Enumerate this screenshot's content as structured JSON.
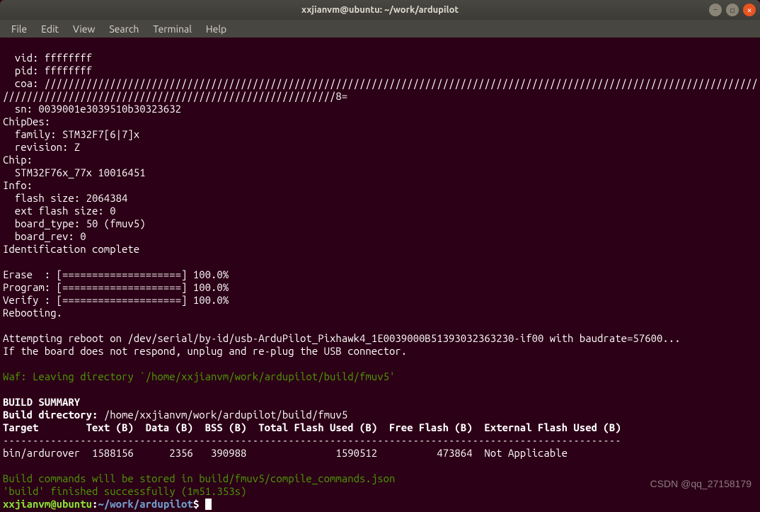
{
  "window": {
    "title": "xxjianvm@ubuntu: ~/work/ardupilot"
  },
  "menu": {
    "file": "File",
    "edit": "Edit",
    "view": "View",
    "search": "Search",
    "terminal": "Terminal",
    "help": "Help"
  },
  "term": {
    "vid": "  vid: ffffffff",
    "pid": "  pid: ffffffff",
    "coa1": "  coa: ////////////////////////////////////////////////////////////////////////////////////////////////////////////////////////",
    "coa2": "////////////////////////////////////////////////////////8=",
    "sn": "  sn: 0039001e3039510b30323632",
    "chipdes": "ChipDes:",
    "family": "  family: STM32F7[6|7]x",
    "revision": "  revision: Z",
    "chip": "Chip:",
    "chipid": "  STM32F76x_77x 10016451",
    "info": "Info:",
    "flash": "  flash size: 2064384",
    "extflash": "  ext flash size: 0",
    "btype": "  board_type: 50 (fmuv5)",
    "brev": "  board_rev: 0",
    "idcomp": "Identification complete",
    "erase": "Erase  : [====================] 100.0%",
    "program": "Program: [====================] 100.0%",
    "verify": "Verify : [====================] 100.0%",
    "reboot": "Rebooting.",
    "attempt": "Attempting reboot on /dev/serial/by-id/usb-ArduPilot_Pixhawk4_1E0039000B51393032363230-if00 with baudrate=57600...",
    "noresp": "If the board does not respond, unplug and re-plug the USB connector.",
    "waf": "Waf: Leaving directory `/home/xxjianvm/work/ardupilot/build/fmuv5'",
    "bsummary": "BUILD SUMMARY",
    "bdir_lbl": "Build directory: ",
    "bdir_val": "/home/xxjianvm/work/ardupilot/build/fmuv5",
    "thead": "Target        Text (B)  Data (B)  BSS (B)  Total Flash Used (B)  Free Flash (B)  External Flash Used (B)",
    "tsep": "--------------------------------------------------------------------------------------------------------",
    "trow": "bin/ardurover  1588156      2356   390988               1590512          473864  Not Applicable",
    "bcmds": "Build commands will be stored in build/fmuv5/compile_commands.json",
    "bfin": "'build' finished successfully (1m51.353s)",
    "p_user": "xxjianvm@ubuntu",
    "p_colon": ":",
    "p_path": "~/work/ardupilot",
    "p_dollar": "$ "
  },
  "watermark": "CSDN @qq_27158179",
  "icons": {
    "min": "–",
    "max": "◻",
    "close": "✕"
  }
}
